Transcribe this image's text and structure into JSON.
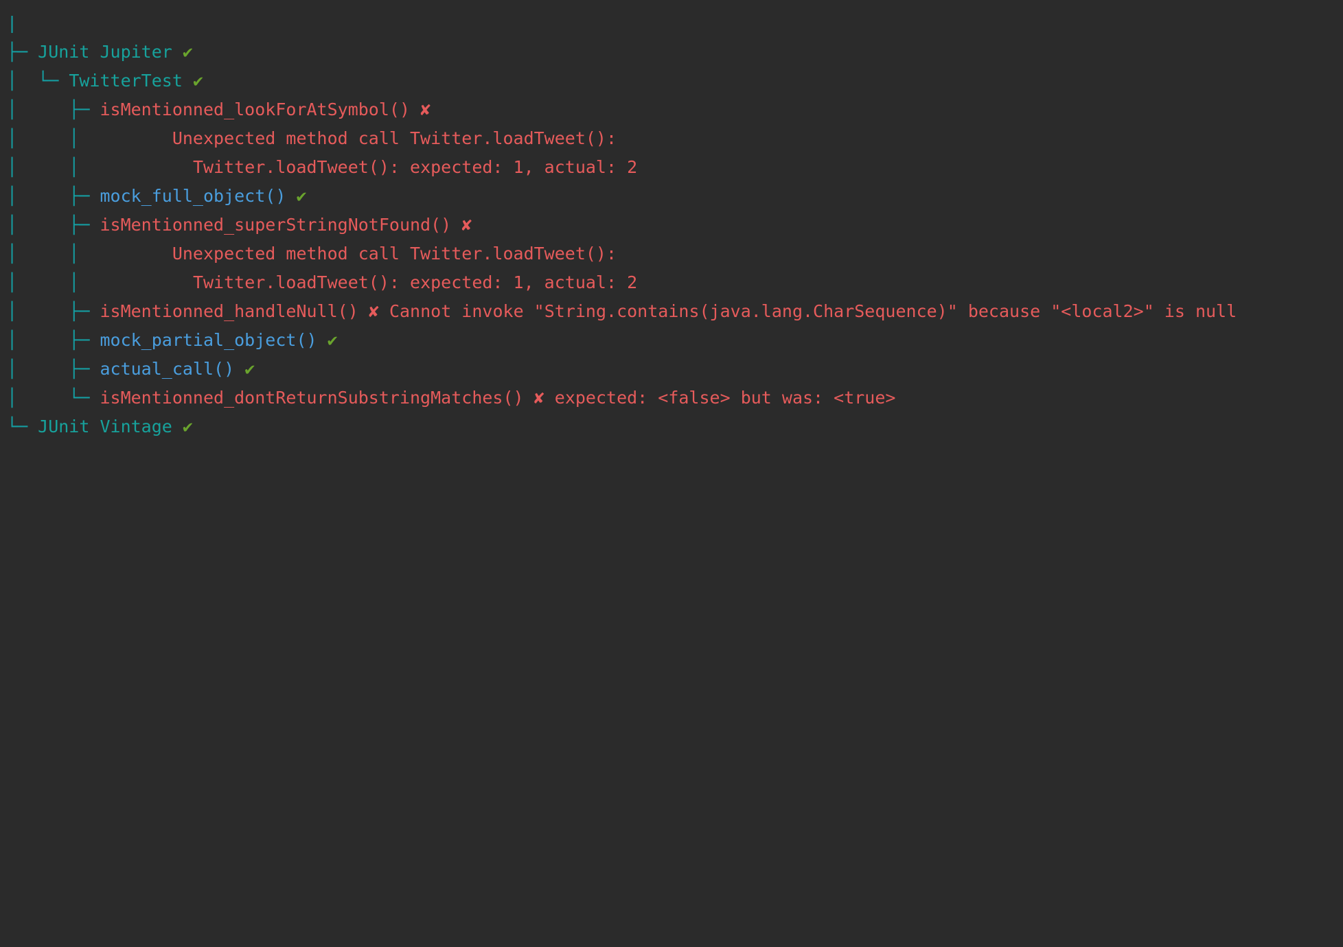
{
  "colors": {
    "background": "#2b2b2b",
    "tree": "#159fa3",
    "container": "#17a29c",
    "passed_test": "#4a9ede",
    "failed_test": "#e65b5b",
    "check_mark": "#6aa42d",
    "cross_mark": "#e65b5b"
  },
  "marks": {
    "pass": "✔",
    "fail": "✘"
  },
  "tree": {
    "root_prefix": "|",
    "engines": [
      {
        "prefix": "├─ ",
        "name": "JUnit Jupiter",
        "status_icon": "check-icon"
      },
      {
        "prefix": "└─ ",
        "name": "JUnit Vintage",
        "status_icon": "check-icon"
      }
    ],
    "test_class": {
      "prefix": "│  └─ ",
      "name": "TwitterTest",
      "status_icon": "check-icon"
    },
    "tests": [
      {
        "prefix": "│     ├─ ",
        "name": "isMentionned_lookForAtSymbol()",
        "status": "failed",
        "message_lines": [
          {
            "prefix": "│     │         ",
            "text": "Unexpected method call Twitter.loadTweet():"
          },
          {
            "prefix": "│     │           ",
            "text": "Twitter.loadTweet(): expected: 1, actual: 2"
          }
        ]
      },
      {
        "prefix": "│     ├─ ",
        "name": "mock_full_object()",
        "status": "passed"
      },
      {
        "prefix": "│     ├─ ",
        "name": "isMentionned_superStringNotFound()",
        "status": "failed",
        "message_lines": [
          {
            "prefix": "│     │         ",
            "text": "Unexpected method call Twitter.loadTweet():"
          },
          {
            "prefix": "│     │           ",
            "text": "Twitter.loadTweet(): expected: 1, actual: 2"
          }
        ]
      },
      {
        "prefix": "│     ├─ ",
        "name": "isMentionned_handleNull()",
        "status": "failed",
        "inline_message": "Cannot invoke \"String.contains(java.lang.CharSequence)\" because \"<local2>\" is null"
      },
      {
        "prefix": "│     ├─ ",
        "name": "mock_partial_object()",
        "status": "passed"
      },
      {
        "prefix": "│     ├─ ",
        "name": "actual_call()",
        "status": "passed"
      },
      {
        "prefix": "│     └─ ",
        "name": "isMentionned_dontReturnSubstringMatches()",
        "status": "failed",
        "inline_message": "expected: <false> but was: <true>"
      }
    ]
  }
}
